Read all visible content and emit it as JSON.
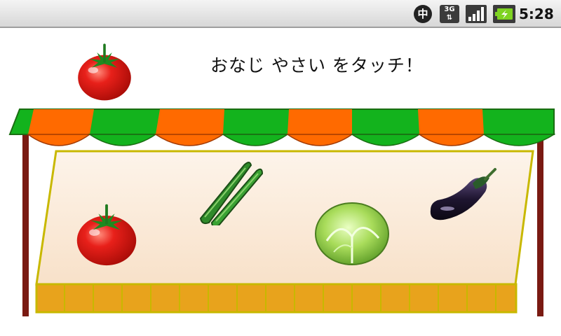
{
  "status_bar": {
    "ime_label": "中",
    "network_label": "3G",
    "time": "5:28",
    "icons": [
      "ime-icon",
      "3g-data-icon",
      "signal-icon",
      "battery-charging-icon"
    ]
  },
  "game": {
    "instruction": "おなじ やさい をタッチ！",
    "target": "tomato",
    "choices": [
      "tomato",
      "okra",
      "cabbage",
      "eggplant"
    ],
    "colors": {
      "awning_orange": "#ff6a00",
      "awning_green": "#13b31d",
      "pole": "#7a1a12",
      "counter_front": "#e8a31c",
      "counter_top": "#fbeee0"
    }
  }
}
